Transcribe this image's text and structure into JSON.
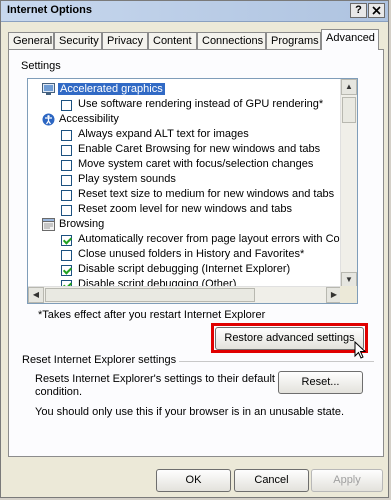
{
  "window": {
    "title": "Internet Options",
    "help_button": "?",
    "close_button": "X"
  },
  "tabs": [
    "General",
    "Security",
    "Privacy",
    "Content",
    "Connections",
    "Programs",
    "Advanced"
  ],
  "settings_group_label": "Settings",
  "settings": [
    {
      "type": "category",
      "label": "Accelerated graphics",
      "icon": "monitor-icon",
      "selected": true
    },
    {
      "type": "checkbox",
      "label": "Use software rendering instead of GPU rendering*",
      "checked": false
    },
    {
      "type": "category",
      "label": "Accessibility",
      "icon": "accessibility-icon"
    },
    {
      "type": "checkbox",
      "label": "Always expand ALT text for images",
      "checked": false
    },
    {
      "type": "checkbox",
      "label": "Enable Caret Browsing for new windows and tabs",
      "checked": false
    },
    {
      "type": "checkbox",
      "label": "Move system caret with focus/selection changes",
      "checked": false
    },
    {
      "type": "checkbox",
      "label": "Play system sounds",
      "checked": false
    },
    {
      "type": "checkbox",
      "label": "Reset text size to medium for new windows and tabs",
      "checked": false
    },
    {
      "type": "checkbox",
      "label": "Reset zoom level for new windows and tabs",
      "checked": false
    },
    {
      "type": "category",
      "label": "Browsing",
      "icon": "browsing-icon"
    },
    {
      "type": "checkbox",
      "label": "Automatically recover from page layout errors with Compa",
      "checked": true
    },
    {
      "type": "checkbox",
      "label": "Close unused folders in History and Favorites*",
      "checked": false
    },
    {
      "type": "checkbox",
      "label": "Disable script debugging (Internet Explorer)",
      "checked": true
    },
    {
      "type": "checkbox",
      "label": "Disable script debugging (Other)",
      "checked": true
    }
  ],
  "restart_note": "*Takes effect after you restart Internet Explorer",
  "restore_button": "Restore advanced settings",
  "reset_section": {
    "title": "Reset Internet Explorer settings",
    "description": "Resets Internet Explorer's settings to their default condition.",
    "reset_button": "Reset...",
    "warning": "You should only use this if your browser is in an unusable state."
  },
  "footer": {
    "ok": "OK",
    "cancel": "Cancel",
    "apply": "Apply"
  }
}
